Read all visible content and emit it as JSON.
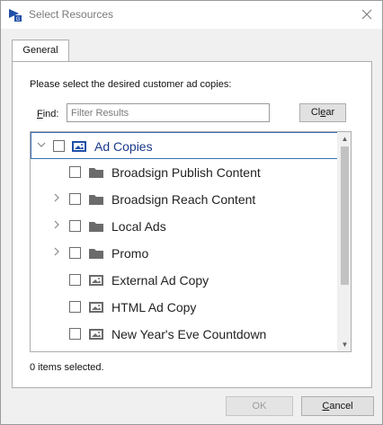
{
  "window": {
    "title": "Select Resources",
    "app_icon": "broadsign-app-icon",
    "close_icon": "close-icon"
  },
  "tabs": [
    {
      "label": "General",
      "active": true
    }
  ],
  "panel": {
    "instructions": "Please select the desired customer ad copies:",
    "find_label_mnemonic": "F",
    "find_label_rest": "ind:",
    "filter_placeholder": "Filter Results",
    "filter_value": "",
    "clear_mnemonic": "e",
    "clear_before": "Cl",
    "clear_after": "ar"
  },
  "tree": {
    "items": [
      {
        "label": "Ad Copies",
        "icon": "ad-copy-icon",
        "expander": "expanded",
        "checked": false,
        "selected": true
      },
      {
        "label": "Broadsign Publish Content",
        "icon": "folder-icon",
        "expander": "none",
        "checked": false
      },
      {
        "label": "Broadsign Reach Content",
        "icon": "folder-icon",
        "expander": "collapsed",
        "checked": false
      },
      {
        "label": "Local Ads",
        "icon": "folder-icon",
        "expander": "collapsed",
        "checked": false
      },
      {
        "label": "Promo",
        "icon": "folder-icon",
        "expander": "collapsed",
        "checked": false
      },
      {
        "label": "External Ad Copy",
        "icon": "ad-copy-icon",
        "expander": "none",
        "checked": false
      },
      {
        "label": "HTML Ad Copy",
        "icon": "ad-copy-icon",
        "expander": "none",
        "checked": false
      },
      {
        "label": "New Year's Eve Countdown",
        "icon": "ad-copy-icon",
        "expander": "none",
        "checked": false
      }
    ]
  },
  "status": {
    "selected_count_text": "0 items selected."
  },
  "footer": {
    "ok_label": "OK",
    "ok_enabled": false,
    "cancel_mnemonic": "C",
    "cancel_rest": "ancel"
  },
  "colors": {
    "selection_border": "#3b6fb5",
    "selected_text": "#1a3a8a",
    "folder": "#6b6b6b",
    "app_icon_blue": "#1f4fa8"
  }
}
